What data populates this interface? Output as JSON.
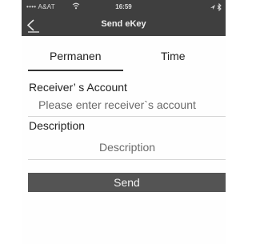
{
  "status": {
    "carrier": "•••• A&AT",
    "time": "16:59",
    "icons": [
      "wifi-icon",
      "location-icon",
      "bluetooth-icon"
    ]
  },
  "nav": {
    "title": "Send eKey",
    "back_icon": "chevron-left-icon"
  },
  "tabs": [
    {
      "label": "Permanen",
      "active": true
    },
    {
      "label": "Time",
      "active": false
    }
  ],
  "form": {
    "account_label": "Receiver’ s Account",
    "account_placeholder": "Please enter receiver`s account",
    "account_value": "",
    "description_label": "Description",
    "description_placeholder": "Description",
    "description_value": ""
  },
  "send_label": "Send",
  "colors": {
    "header_bg": "#3f3f3f",
    "button_bg": "#545454",
    "divider": "#d6d6d6"
  }
}
